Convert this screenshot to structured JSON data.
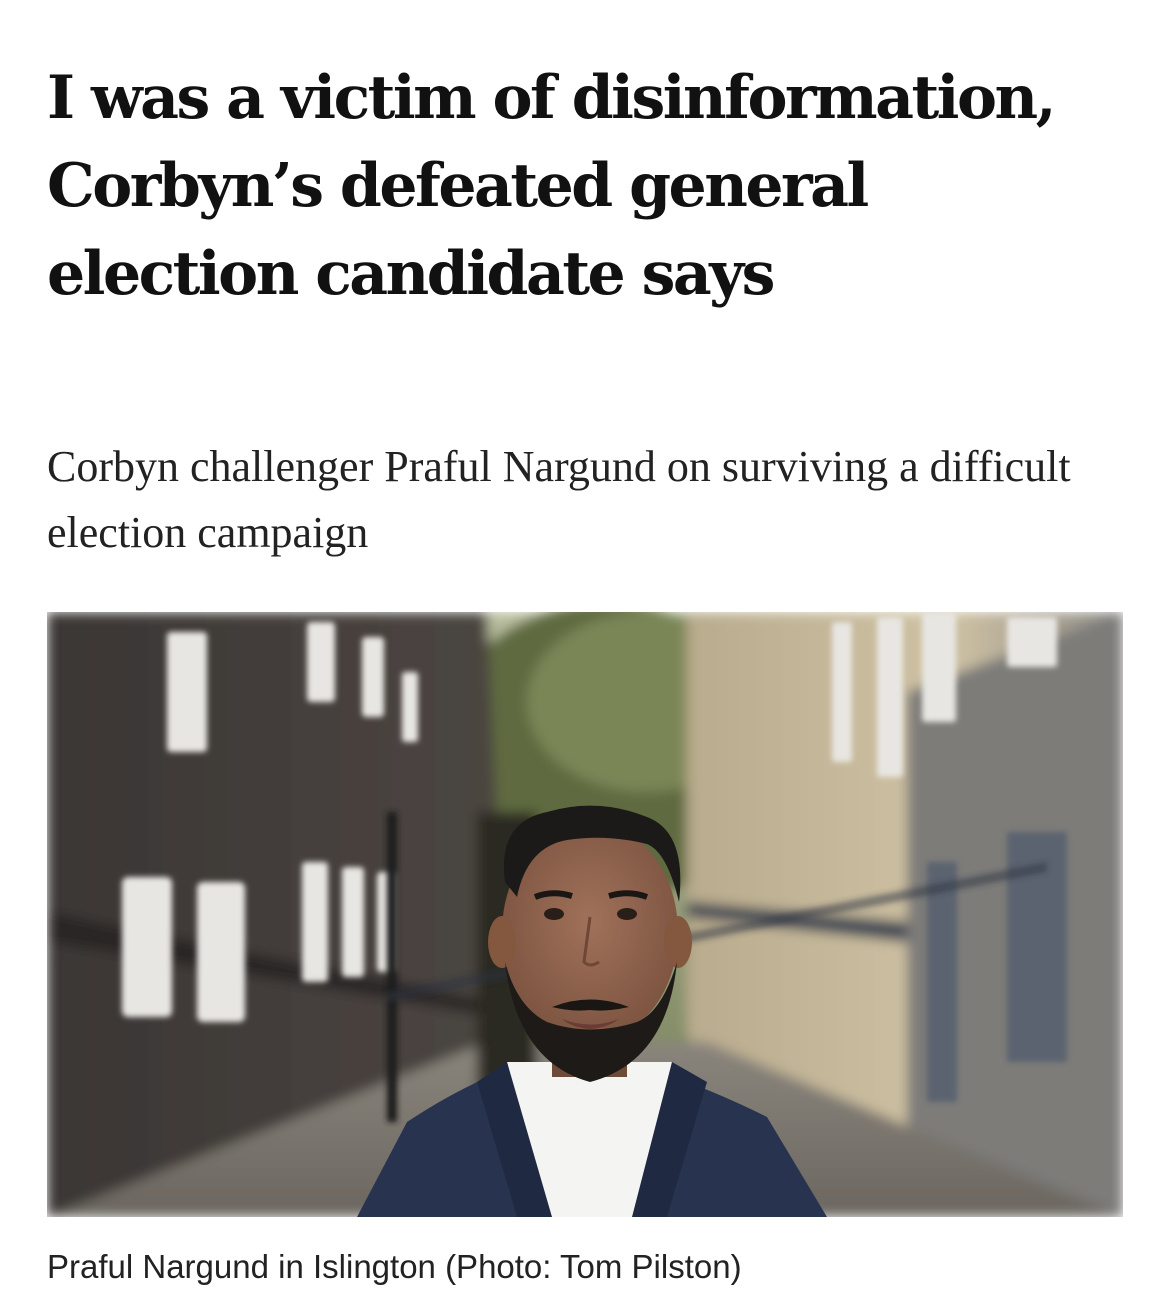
{
  "article": {
    "headline": "I was a victim of disinformation, Corbyn’s defeated general election candidate says",
    "standfirst": "Corbyn challenger Praful Nargund on surviving a difficult election campaign",
    "image": {
      "caption": "Praful Nargund in Islington (Photo: Tom Pilston)"
    }
  }
}
